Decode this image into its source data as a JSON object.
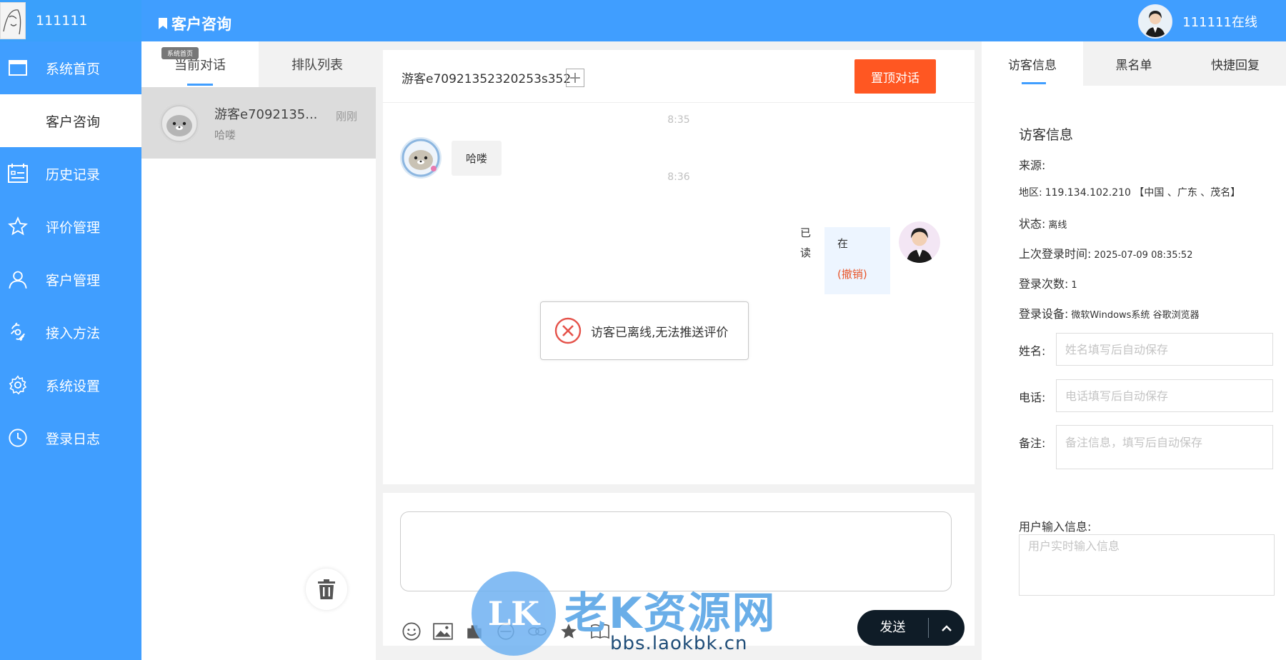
{
  "sidebar": {
    "user_name": "111111",
    "items": [
      {
        "label": "系统首页",
        "icon": "window-icon"
      },
      {
        "label": "客户咨询",
        "icon": "chat-icon"
      },
      {
        "label": "历史记录",
        "icon": "history-list-icon"
      },
      {
        "label": "评价管理",
        "icon": "star-icon"
      },
      {
        "label": "客户管理",
        "icon": "user-icon"
      },
      {
        "label": "接入方法",
        "icon": "plug-icon"
      },
      {
        "label": "系统设置",
        "icon": "gear-icon"
      },
      {
        "label": "登录日志",
        "icon": "clock-icon"
      }
    ],
    "active_index": 1
  },
  "header": {
    "title": "客户咨询",
    "agent_status": "111111在线"
  },
  "conv_list": {
    "tabs": [
      "当前对话",
      "排队列表"
    ],
    "tooltip": "系统首页",
    "items": [
      {
        "name": "游客e7092135...",
        "last_msg": "哈喽",
        "time": "刚刚"
      }
    ]
  },
  "chat": {
    "visitor": "游客e70921352320253s352",
    "pin_label": "置顶对话",
    "messages": [
      {
        "time": "8:35",
        "from": "visitor",
        "text": "哈喽"
      },
      {
        "time": "8:36",
        "from": "agent",
        "text": "在",
        "read_flag": "已读",
        "revoke": "(撤销)"
      }
    ],
    "toast": "访客已离线,无法推送评价",
    "send_label": "发送"
  },
  "right": {
    "tabs": [
      "访客信息",
      "黑名单",
      "快捷回复"
    ],
    "section_title": "访客信息",
    "source_label": "来源:",
    "source_value": "",
    "region_label": "地区:",
    "region_value": "119.134.102.210 【中国 、广东 、茂名】",
    "status_label": "状态:",
    "status_value": "离线",
    "last_login_label": "上次登录时间:",
    "last_login_value": "2025-07-09 08:35:52",
    "login_count_label": "登录次数:",
    "login_count_value": "1",
    "device_label": "登录设备:",
    "device_value": "微软Windows系统 谷歌浏览器",
    "name_label": "姓名:",
    "name_placeholder": "姓名填写后自动保存",
    "phone_label": "电话:",
    "phone_placeholder": "电话填写后自动保存",
    "note_label": "备注:",
    "note_placeholder": "备注信息，填写后自动保存",
    "live_label": "用户输入信息:",
    "live_placeholder": "用户实时输入信息"
  },
  "watermark": {
    "logo": "LK",
    "brand": "老K资源网",
    "url": "bbs.laokbk.cn"
  },
  "colors": {
    "primary": "#409eff",
    "pin": "#ff5722",
    "revoke": "#e8552a",
    "send_bg": "#0f1c27"
  }
}
